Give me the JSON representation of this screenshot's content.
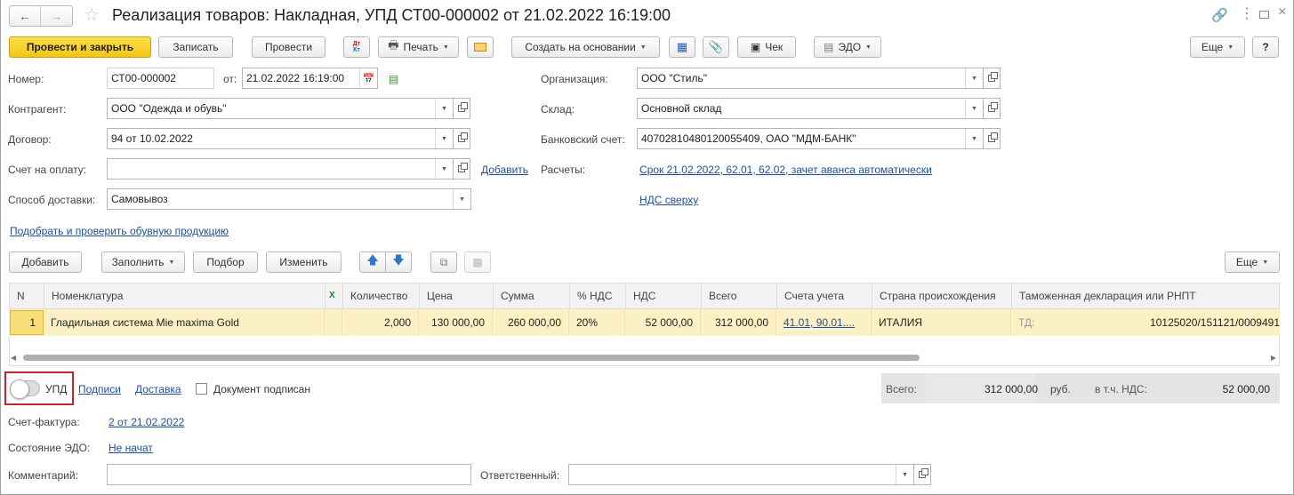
{
  "window": {
    "title": "Реализация товаров: Накладная, УПД СТ00-000002 от 21.02.2022 16:19:00"
  },
  "toolbar": {
    "post_close": "Провести и закрыть",
    "save": "Записать",
    "post": "Провести",
    "dtkt": "Дт Кт",
    "print": "Печать",
    "create_based": "Создать на основании",
    "check": "Чек",
    "edo": "ЭДО",
    "more": "Еще",
    "help": "?"
  },
  "form": {
    "number_label": "Номер:",
    "number_value": "СТ00-000002",
    "date_label": "от:",
    "date_value": "21.02.2022 16:19:00",
    "counterparty_label": "Контрагент:",
    "counterparty_value": "ООО \"Одежда и обувь\"",
    "contract_label": "Договор:",
    "contract_value": "94 от 10.02.2022",
    "invoice_label": "Счет на оплату:",
    "invoice_value": "",
    "add_link": "Добавить",
    "delivery_label": "Способ доставки:",
    "delivery_value": "Самовывоз",
    "org_label": "Организация:",
    "org_value": "ООО \"Стиль\"",
    "warehouse_label": "Склад:",
    "warehouse_value": "Основной склад",
    "bank_label": "Банковский счет:",
    "bank_value": "40702810480120055409, ОАО \"МДМ-БАНК\"",
    "settlements_label": "Расчеты:",
    "settlements_link": "Срок 21.02.2022, 62.01, 62.02, зачет аванса автоматически",
    "vat_link": "НДС сверху",
    "shoes_link": "Подобрать и проверить обувную продукцию"
  },
  "table_toolbar": {
    "add": "Добавить",
    "fill": "Заполнить",
    "pick": "Подбор",
    "change": "Изменить",
    "more": "Еще"
  },
  "table": {
    "headers": [
      "N",
      "Номенклатура",
      "Количество",
      "Цена",
      "Сумма",
      "% НДС",
      "НДС",
      "Всего",
      "Счета учета",
      "Страна происхождения",
      "Таможенная декларация или РНПТ"
    ],
    "rows": [
      {
        "n": "1",
        "item": "Гладильная система Mie maxima Gold",
        "qty": "2,000",
        "price": "130 000,00",
        "sum": "260 000,00",
        "vat_rate": "20%",
        "vat": "52 000,00",
        "total": "312 000,00",
        "accounts": "41.01, 90.01....",
        "country": "ИТАЛИЯ",
        "td_label": "ТД:",
        "td_value": "10125020/151121/0009491"
      }
    ]
  },
  "footer": {
    "upd_label": "УПД",
    "signatures_link": "Подписи",
    "delivery_link": "Доставка",
    "signed_label": "Документ подписан",
    "total_label": "Всего:",
    "total_value": "312 000,00",
    "currency": "руб.",
    "vat_label": "в т.ч. НДС:",
    "vat_value": "52 000,00",
    "invoice_label": "Счет-фактура:",
    "invoice_link": "2 от 21.02.2022",
    "edo_state_label": "Состояние ЭДО:",
    "edo_state_link": "Не начат",
    "comment_label": "Комментарий:",
    "comment_value": "",
    "responsible_label": "Ответственный:",
    "responsible_value": ""
  },
  "colors": {
    "primary_button": "#f3c515",
    "link": "#1f4f9c",
    "selected_row": "#fbf1c5",
    "highlight_frame": "#c0262c"
  }
}
